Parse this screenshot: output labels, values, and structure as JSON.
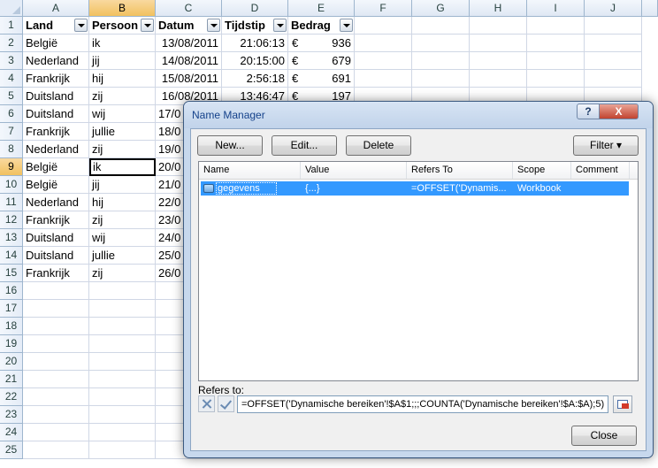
{
  "sheet": {
    "columns": [
      "A",
      "B",
      "C",
      "D",
      "E",
      "F",
      "G",
      "H",
      "I",
      "J"
    ],
    "selected_column": "B",
    "selected_row": 9,
    "rows": [
      "1",
      "2",
      "3",
      "4",
      "5",
      "6",
      "7",
      "8",
      "9",
      "10",
      "11",
      "12",
      "13",
      "14",
      "15",
      "16",
      "17",
      "18",
      "19",
      "20",
      "21",
      "22",
      "23",
      "24",
      "25"
    ],
    "headers": [
      "Land",
      "Persoon",
      "Datum",
      "Tijdstip",
      "Bedrag"
    ],
    "currency_symbol": "€",
    "data": [
      [
        "België",
        "ik",
        "13/08/2011",
        "21:06:13",
        "936"
      ],
      [
        "Nederland",
        "jij",
        "14/08/2011",
        "20:15:00",
        "679"
      ],
      [
        "Frankrijk",
        "hij",
        "15/08/2011",
        "2:56:18",
        "691"
      ],
      [
        "Duitsland",
        "zij",
        "16/08/2011",
        "13:46:47",
        "197"
      ],
      [
        "Duitsland",
        "wij",
        "17/0",
        "",
        ""
      ],
      [
        "Frankrijk",
        "jullie",
        "18/0",
        "",
        ""
      ],
      [
        "Nederland",
        "zij",
        "19/0",
        "",
        ""
      ],
      [
        "België",
        "ik",
        "20/0",
        "",
        ""
      ],
      [
        "België",
        "jij",
        "21/0",
        "",
        ""
      ],
      [
        "Nederland",
        "hij",
        "22/0",
        "",
        ""
      ],
      [
        "Frankrijk",
        "zij",
        "23/0",
        "",
        ""
      ],
      [
        "Duitsland",
        "wij",
        "24/0",
        "",
        ""
      ],
      [
        "Duitsland",
        "jullie",
        "25/0",
        "",
        ""
      ],
      [
        "Frankrijk",
        "zij",
        "26/0",
        "",
        ""
      ]
    ]
  },
  "dialog": {
    "title": "Name Manager",
    "help_label": "?",
    "close_x": "X",
    "buttons": {
      "new": "New...",
      "edit": "Edit...",
      "delete": "Delete",
      "filter": "Filter ▾",
      "close": "Close"
    },
    "list_headers": [
      "Name",
      "Value",
      "Refers To",
      "Scope",
      "Comment"
    ],
    "names": [
      {
        "name": "gegevens",
        "value": "{...}",
        "refers_to": "=OFFSET('Dynamis...",
        "scope": "Workbook",
        "comment": ""
      }
    ],
    "refers_to_label": "Refers to:",
    "refers_to_formula": "=OFFSET('Dynamische bereiken'!$A$1;;;COUNTA('Dynamische bereiken'!$A:$A);5)"
  }
}
